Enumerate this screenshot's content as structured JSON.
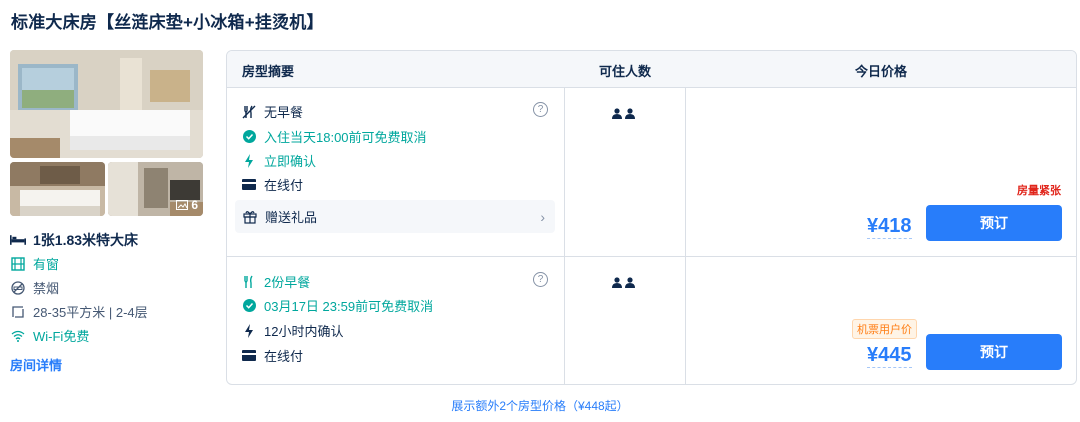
{
  "room_title": "标准大床房【丝涟床垫+小冰箱+挂烫机】",
  "photos": {
    "count": "6"
  },
  "features": {
    "bed": "1张1.83米特大床",
    "window": "有窗",
    "smoking": "禁烟",
    "area": "28-35平方米 | 2-4层",
    "wifi": "Wi-Fi免费",
    "details_link": "房间详情"
  },
  "table": {
    "headers": [
      "房型摘要",
      "可住人数",
      "今日价格"
    ],
    "rows": [
      {
        "meal": "无早餐",
        "cancel": "入住当天18:00前可免费取消",
        "confirm": "立即确认",
        "pay": "在线付",
        "gift": "赠送礼品",
        "tag": "房量紧张",
        "price": "¥418",
        "book": "预订"
      },
      {
        "meal": "2份早餐",
        "cancel": "03月17日 23:59前可免费取消",
        "confirm": "12小时内确认",
        "pay": "在线付",
        "tag": "机票用户价",
        "price": "¥445",
        "book": "预订"
      }
    ]
  },
  "more_link": "展示额外2个房型价格（¥448起）",
  "colors": {
    "accent": "#287dfa",
    "green": "#00a79d",
    "warn": "#e1251b",
    "orange": "#ff7d13"
  }
}
